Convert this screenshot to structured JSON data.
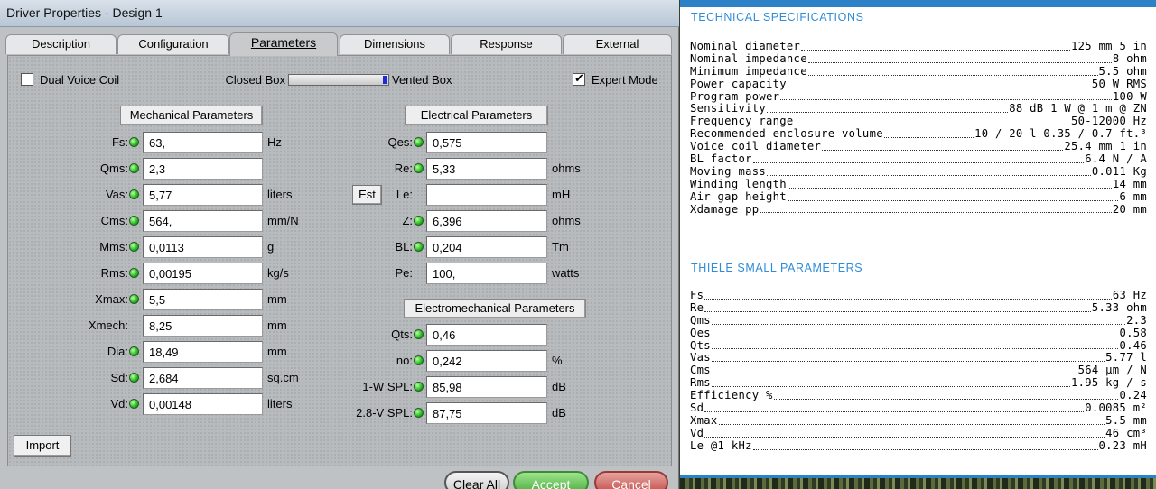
{
  "dialog": {
    "title": "Driver Properties - Design 1",
    "tabs": [
      "Description",
      "Configuration",
      "Parameters",
      "Dimensions",
      "Response",
      "External"
    ],
    "active_tab": "Parameters",
    "dual_voice_coil": {
      "label": "Dual Voice Coil",
      "checked": false
    },
    "box_slider": {
      "left_label": "Closed Box",
      "right_label": "Vented Box",
      "value": 1.0
    },
    "expert_mode": {
      "label": "Expert Mode",
      "checked": true
    },
    "mechanical": {
      "title": "Mechanical Parameters",
      "rows": [
        {
          "label": "Fs:",
          "value": "63,",
          "unit": "Hz",
          "led": true
        },
        {
          "label": "Qms:",
          "value": "2,3",
          "unit": "",
          "led": true
        },
        {
          "label": "Vas:",
          "value": "5,77",
          "unit": "liters",
          "led": true
        },
        {
          "label": "Cms:",
          "value": "564,",
          "unit": "mm/N",
          "led": true
        },
        {
          "label": "Mms:",
          "value": "0,0113",
          "unit": "g",
          "led": true
        },
        {
          "label": "Rms:",
          "value": "0,00195",
          "unit": "kg/s",
          "led": true
        },
        {
          "label": "Xmax:",
          "value": "5,5",
          "unit": "mm",
          "led": true
        },
        {
          "label": "Xmech:",
          "value": "8,25",
          "unit": "mm",
          "led": false
        },
        {
          "label": "Dia:",
          "value": "18,49",
          "unit": "mm",
          "led": true
        },
        {
          "label": "Sd:",
          "value": "2,684",
          "unit": "sq.cm",
          "led": true
        },
        {
          "label": "Vd:",
          "value": "0,00148",
          "unit": "liters",
          "led": true
        }
      ]
    },
    "electrical": {
      "title": "Electrical Parameters",
      "est_label": "Est",
      "rows": [
        {
          "label": "Qes:",
          "value": "0,575",
          "unit": "",
          "led": true
        },
        {
          "label": "Re:",
          "value": "5,33",
          "unit": "ohms",
          "led": true
        },
        {
          "label": "Le:",
          "value": "",
          "unit": "mH",
          "led": false
        },
        {
          "label": "Z:",
          "value": "6,396",
          "unit": "ohms",
          "led": true
        },
        {
          "label": "BL:",
          "value": "0,204",
          "unit": "Tm",
          "led": true
        },
        {
          "label": "Pe:",
          "value": "100,",
          "unit": "watts",
          "led": false
        }
      ]
    },
    "electromechanical": {
      "title": "Electromechanical Parameters",
      "rows": [
        {
          "label": "Qts:",
          "value": "0,46",
          "unit": "",
          "led": true
        },
        {
          "label": "no:",
          "value": "0,242",
          "unit": "%",
          "led": true
        },
        {
          "label": "1-W SPL:",
          "value": "85,98",
          "unit": "dB",
          "led": true
        },
        {
          "label": "2.8-V SPL:",
          "value": "87,75",
          "unit": "dB",
          "led": true
        }
      ]
    },
    "buttons": {
      "import": "Import",
      "clear_all": "Clear All",
      "accept": "Accept",
      "cancel": "Cancel"
    },
    "colors": {
      "accept": "#4bb043",
      "cancel": "#c4514b",
      "led": "#22b81c",
      "slider_thumb": "#1d2cd6"
    }
  },
  "spec_sheet": {
    "technical": {
      "heading": "TECHNICAL SPECIFICATIONS",
      "rows": [
        {
          "k": "Nominal diameter",
          "v": "125 mm 5 in"
        },
        {
          "k": "Nominal impedance",
          "v": "8 ohm"
        },
        {
          "k": "Minimum impedance",
          "v": "5.5 ohm"
        },
        {
          "k": "Power capacity",
          "v": "50 W RMS"
        },
        {
          "k": "Program power",
          "v": "100 W"
        },
        {
          "k": "Sensitivity",
          "v": "88 dB 1 W @ 1 m @ ZN"
        },
        {
          "k": "Frequency range",
          "v": "50-12000 Hz"
        },
        {
          "k": "Recommended enclosure volume",
          "v": "10 / 20 l 0.35 / 0.7 ft.³"
        },
        {
          "k": "Voice coil diameter",
          "v": "25.4 mm 1 in"
        },
        {
          "k": "BL factor",
          "v": "6.4 N / A"
        },
        {
          "k": "Moving mass",
          "v": "0.011 Kg"
        },
        {
          "k": "Winding length",
          "v": "14 mm"
        },
        {
          "k": "Air gap height",
          "v": "6 mm"
        },
        {
          "k": "Xdamage pp",
          "v": "20 mm"
        }
      ]
    },
    "thiele": {
      "heading": "THIELE SMALL PARAMETERS",
      "rows": [
        {
          "k": "Fs",
          "v": "63 Hz"
        },
        {
          "k": "Re",
          "v": "5.33 ohm"
        },
        {
          "k": "Qms",
          "v": "2.3"
        },
        {
          "k": "Qes",
          "v": "0.58"
        },
        {
          "k": "Qts",
          "v": "0.46"
        },
        {
          "k": "Vas",
          "v": "5.77 l"
        },
        {
          "k": "Cms",
          "v": "564 µm / N"
        },
        {
          "k": "Rms",
          "v": "1.95 kg / s"
        },
        {
          "k": "Efficiency %",
          "v": "0.24"
        },
        {
          "k": "Sd",
          "v": "0.0085 m²"
        },
        {
          "k": "Xmax",
          "v": "5.5 mm"
        },
        {
          "k": "Vd",
          "v": "46 cm³"
        },
        {
          "k": "Le @1 kHz",
          "v": "0.23 mH"
        }
      ]
    },
    "colors": {
      "heading": "#2f8cd9",
      "bar": "#2d81c7"
    }
  }
}
